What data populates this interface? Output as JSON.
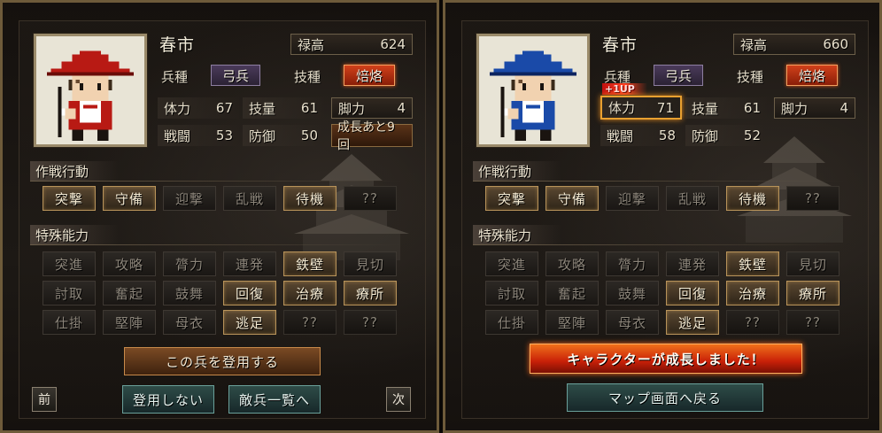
{
  "left": {
    "name": "春市",
    "stipend_label": "禄高",
    "stipend_value": "624",
    "unit_label": "兵種",
    "unit_value": "弓兵",
    "skill_label": "技種",
    "skill_value": "焙烙",
    "stats": {
      "hp_label": "体力",
      "hp_value": "67",
      "tech_label": "技量",
      "tech_value": "61",
      "leg_label": "脚力",
      "leg_value": "4",
      "atk_label": "戦闘",
      "atk_value": "53",
      "def_label": "防御",
      "def_value": "50"
    },
    "growth_text": "成長あと9回",
    "tactics_title": "作戦行動",
    "tactics": [
      {
        "label": "突撃",
        "active": true
      },
      {
        "label": "守備",
        "active": true
      },
      {
        "label": "迎撃",
        "active": false
      },
      {
        "label": "乱戦",
        "active": false
      },
      {
        "label": "待機",
        "active": true
      },
      {
        "label": "??",
        "active": false
      }
    ],
    "abilities_title": "特殊能力",
    "abilities": [
      {
        "label": "突進",
        "active": false
      },
      {
        "label": "攻略",
        "active": false
      },
      {
        "label": "膂力",
        "active": false
      },
      {
        "label": "連発",
        "active": false
      },
      {
        "label": "鉄壁",
        "active": true
      },
      {
        "label": "見切",
        "active": false
      },
      {
        "label": "討取",
        "active": false
      },
      {
        "label": "奮起",
        "active": false
      },
      {
        "label": "鼓舞",
        "active": false
      },
      {
        "label": "回復",
        "active": true
      },
      {
        "label": "治療",
        "active": true
      },
      {
        "label": "療所",
        "active": true
      },
      {
        "label": "仕掛",
        "active": false
      },
      {
        "label": "堅陣",
        "active": false
      },
      {
        "label": "母衣",
        "active": false
      },
      {
        "label": "逃足",
        "active": true
      },
      {
        "label": "??",
        "active": false
      },
      {
        "label": "??",
        "active": false
      }
    ],
    "recruit_button": "この兵を登用する",
    "decline_button": "登用しない",
    "enemy_list_button": "敵兵一覧へ",
    "prev_button": "前",
    "next_button": "次",
    "colors": {
      "hat": "#b81a14",
      "robe": "#b81a14"
    }
  },
  "right": {
    "name": "春市",
    "stipend_label": "禄高",
    "stipend_value": "660",
    "unit_label": "兵種",
    "unit_value": "弓兵",
    "skill_label": "技種",
    "skill_value": "焙烙",
    "levelup_badge": "+1UP",
    "stats": {
      "hp_label": "体力",
      "hp_value": "71",
      "tech_label": "技量",
      "tech_value": "61",
      "leg_label": "脚力",
      "leg_value": "4",
      "atk_label": "戦闘",
      "atk_value": "58",
      "def_label": "防御",
      "def_value": "52"
    },
    "tactics_title": "作戦行動",
    "tactics": [
      {
        "label": "突撃",
        "active": true
      },
      {
        "label": "守備",
        "active": true
      },
      {
        "label": "迎撃",
        "active": false
      },
      {
        "label": "乱戦",
        "active": false
      },
      {
        "label": "待機",
        "active": true
      },
      {
        "label": "??",
        "active": false
      }
    ],
    "abilities_title": "特殊能力",
    "abilities": [
      {
        "label": "突進",
        "active": false
      },
      {
        "label": "攻略",
        "active": false
      },
      {
        "label": "膂力",
        "active": false
      },
      {
        "label": "連発",
        "active": false
      },
      {
        "label": "鉄壁",
        "active": true
      },
      {
        "label": "見切",
        "active": false
      },
      {
        "label": "討取",
        "active": false
      },
      {
        "label": "奮起",
        "active": false
      },
      {
        "label": "鼓舞",
        "active": false
      },
      {
        "label": "回復",
        "active": true
      },
      {
        "label": "治療",
        "active": true
      },
      {
        "label": "療所",
        "active": true
      },
      {
        "label": "仕掛",
        "active": false
      },
      {
        "label": "堅陣",
        "active": false
      },
      {
        "label": "母衣",
        "active": false
      },
      {
        "label": "逃足",
        "active": true
      },
      {
        "label": "??",
        "active": false
      },
      {
        "label": "??",
        "active": false
      }
    ],
    "growth_banner": "キャラクターが成長しました！",
    "return_button": "マップ画面へ戻る",
    "colors": {
      "hat": "#1a4aa8",
      "robe": "#1a4aa8"
    }
  }
}
